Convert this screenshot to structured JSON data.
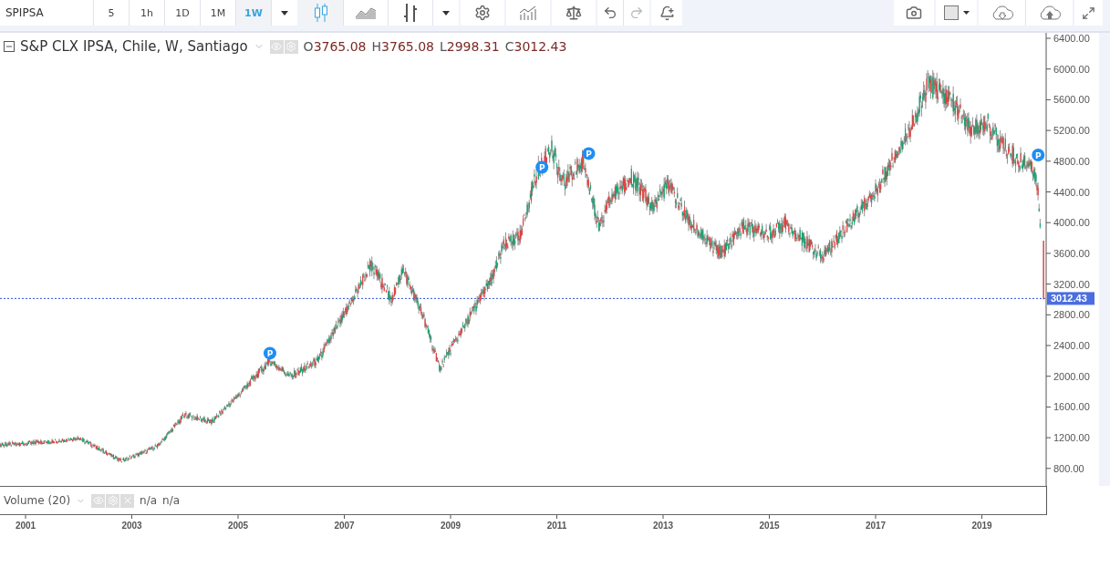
{
  "toolbar": {
    "symbol": "SPIPSA",
    "intervals": [
      {
        "label": "5",
        "selected": false
      },
      {
        "label": "1h",
        "selected": false
      },
      {
        "label": "1D",
        "selected": false
      },
      {
        "label": "1M",
        "selected": false
      },
      {
        "label": "1W",
        "selected": true
      }
    ]
  },
  "legend": {
    "title": "S&P CLX IPSA, Chile, W, Santiago",
    "ohlc": [
      {
        "key": "O",
        "value": "3765.08"
      },
      {
        "key": "H",
        "value": "3765.08"
      },
      {
        "key": "L",
        "value": "2998.31"
      },
      {
        "key": "C",
        "value": "3012.43"
      }
    ]
  },
  "price_axis": {
    "ticks": [
      "6400.00",
      "6000.00",
      "5600.00",
      "5200.00",
      "4800.00",
      "4400.00",
      "4000.00",
      "3600.00",
      "3200.00",
      "2800.00",
      "2400.00",
      "2000.00",
      "1600.00",
      "1200.00",
      "800.00"
    ],
    "last_price": "3012.43"
  },
  "markers": [
    "P",
    "P",
    "P",
    "P"
  ],
  "volume_pane": {
    "title": "Volume (20)",
    "values": [
      "n/a",
      "n/a"
    ]
  },
  "time_axis": [
    "2001",
    "2003",
    "2005",
    "2007",
    "2009",
    "2011",
    "2013",
    "2015",
    "2017",
    "2019"
  ]
}
